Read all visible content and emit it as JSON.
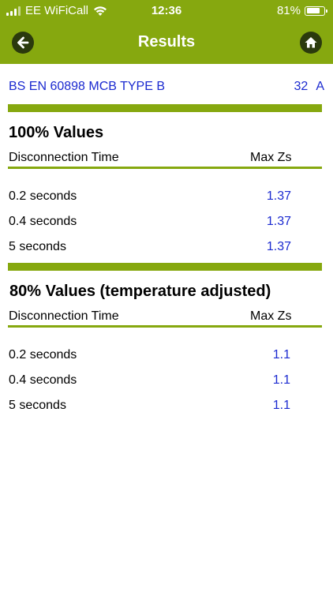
{
  "status_bar": {
    "carrier": "EE WiFiCall",
    "time": "12:36",
    "battery": "81%",
    "battery_level_pct": 81
  },
  "nav": {
    "title": "Results",
    "back_icon": "back-arrow-icon",
    "home_icon": "home-icon"
  },
  "breaker": {
    "name": "BS EN 60898 MCB TYPE B",
    "rating": "32",
    "unit": "A"
  },
  "sections": [
    {
      "title": "100% Values",
      "col_time": "Disconnection Time",
      "col_value": "Max Zs",
      "rows": [
        {
          "time": "0.2 seconds",
          "value": "1.37"
        },
        {
          "time": "0.4 seconds",
          "value": "1.37"
        },
        {
          "time": "5 seconds",
          "value": "1.37"
        }
      ]
    },
    {
      "title": "80% Values (temperature adjusted)",
      "col_time": "Disconnection Time",
      "col_value": "Max Zs",
      "rows": [
        {
          "time": "0.2 seconds",
          "value": "1.1"
        },
        {
          "time": "0.4 seconds",
          "value": "1.1"
        },
        {
          "time": "5 seconds",
          "value": "1.1"
        }
      ]
    }
  ],
  "colors": {
    "accent_green": "#86a80f",
    "value_blue": "#1b2ad0",
    "button_dark": "#2b3a0d"
  }
}
